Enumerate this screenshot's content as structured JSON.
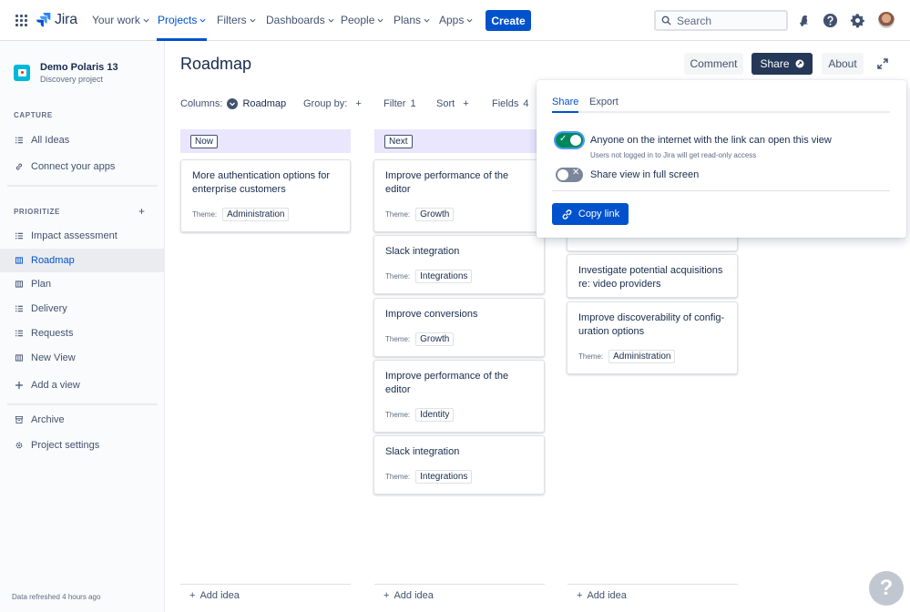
{
  "topnav": {
    "brand": "Jira",
    "items": [
      {
        "label": "Your work"
      },
      {
        "label": "Projects"
      },
      {
        "label": "Filters"
      },
      {
        "label": "Dashboards"
      },
      {
        "label": "People"
      },
      {
        "label": "Plans"
      },
      {
        "label": "Apps"
      }
    ],
    "create_label": "Create",
    "search_placeholder": "Search",
    "icons": [
      "notification-icon",
      "help-icon",
      "settings-icon"
    ]
  },
  "sidebar": {
    "project_name": "Demo Polaris 13",
    "project_type": "Discovery project",
    "capture_label": "CAPTURE",
    "capture_items": [
      {
        "label": "All Ideas",
        "icon": "list-icon"
      },
      {
        "label": "Connect your apps",
        "icon": "link-icon"
      }
    ],
    "prioritize_label": "PRIORITIZE",
    "prioritize_items": [
      {
        "label": "Impact assessment",
        "icon": "list-icon"
      },
      {
        "label": "Roadmap",
        "icon": "board-icon",
        "active": true
      },
      {
        "label": "Plan",
        "icon": "board-icon"
      },
      {
        "label": "Delivery",
        "icon": "list-icon"
      },
      {
        "label": "Requests",
        "icon": "list-icon"
      },
      {
        "label": "New View",
        "icon": "board-icon"
      }
    ],
    "add_view_label": "Add a view",
    "archive_label": "Archive",
    "settings_label": "Project settings",
    "refreshed_text": "Data refreshed 4 hours ago"
  },
  "header": {
    "title": "Roadmap",
    "comment_label": "Comment",
    "share_label": "Share",
    "about_label": "About"
  },
  "toolbar": {
    "columns_label": "Columns:",
    "columns_value": "Roadmap",
    "group_by_label": "Group by:",
    "filter_label": "Filter",
    "filter_count": "1",
    "sort_label": "Sort",
    "fields_label": "Fields",
    "fields_count": "4"
  },
  "board": {
    "theme_label": "Theme:",
    "add_idea_label": "Add idea",
    "columns": [
      {
        "name": "Now",
        "cards": [
          {
            "title": "More authentication options for enterprise customers",
            "theme": "Administration"
          }
        ]
      },
      {
        "name": "Next",
        "cards": [
          {
            "title": "Improve performance of the editor",
            "theme": "Growth"
          },
          {
            "title": "Slack integration",
            "theme": "Integrations"
          },
          {
            "title": "Improve conversions",
            "theme": "Growth"
          },
          {
            "title": "Improve performance of the editor",
            "theme": "Identity"
          },
          {
            "title": "Slack integration",
            "theme": "Integrations"
          }
        ]
      },
      {
        "name": "",
        "cards": [
          {
            "title": "Investigate potential acquisitions re: video providers",
            "theme": ""
          },
          {
            "title": "Improve discoverability of config-uration options",
            "theme": "Administration"
          }
        ]
      }
    ]
  },
  "share_popover": {
    "tab_share": "Share",
    "tab_export": "Export",
    "public_link_text": "Anyone on the internet with the link can open this view",
    "public_link_note": "Users not logged in to Jira will get read-only access",
    "public_link_enabled": true,
    "fullscreen_text": "Share view in full screen",
    "fullscreen_enabled": false,
    "copy_link_label": "Copy link"
  },
  "colors": {
    "primary": "#0052cc",
    "nav_text": "#42526e",
    "column_header_bg": "#e9e6fd",
    "toggle_on": "#00875a",
    "toggle_off": "#7a869a",
    "share_button_bg": "#253858"
  }
}
